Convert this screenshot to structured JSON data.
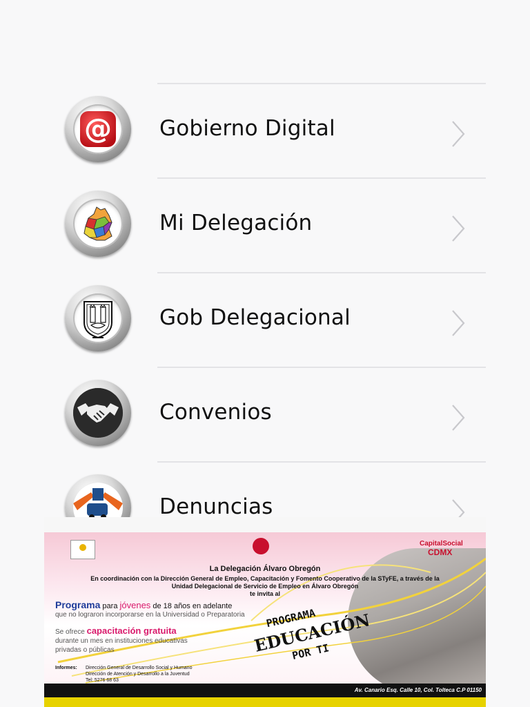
{
  "menu": {
    "items": [
      {
        "label": "Gobierno Digital",
        "icon": "at-sign-icon"
      },
      {
        "label": "Mi Delegación",
        "icon": "delegation-map-icon"
      },
      {
        "label": "Gob Delegacional",
        "icon": "coat-of-arms-icon"
      },
      {
        "label": "Convenios",
        "icon": "handshake-icon"
      },
      {
        "label": "Denuncias",
        "icon": "report-icon"
      }
    ]
  },
  "banner": {
    "capital_label": "CapitalSocial",
    "cdmx_label": "CDMX",
    "title": "La Delegación Álvaro Obregón",
    "line1": "En coordinación con la Dirección General de Empleo, Capacitación y Fomento Cooperativo de la STyFE, a través de la",
    "line2": "Unidad Delegacional de Servicio de Empleo en Álvaro Obregón",
    "line3": "te invita al",
    "programa_word": "Programa",
    "para_word": " para ",
    "jovenes_word": "jóvenes",
    "age_text": " de 18 años en adelante",
    "line_no_lograron": "que no lograron incorporarse en la Universidad o Preparatoria",
    "se_ofrece": "Se ofrece ",
    "capacitacion": "capacitación gratuita",
    "durante": "durante un mes en instituciones educativas",
    "privadas": "privadas o públicas",
    "informes_label": "Informes:",
    "informes_1": "Dirección General de Desarrollo Social y Humano",
    "informes_2": "Dirección de Atención y Desarrollo a la Juventud",
    "informes_3": "Tel: 5276 68 63",
    "stamp_1": "PROGRAMA",
    "stamp_2": "EDUCACIÓN",
    "stamp_3": "POR TI",
    "footer": "Av. Canario Esq. Calle 10, Col. Tolteca C.P 01150"
  }
}
